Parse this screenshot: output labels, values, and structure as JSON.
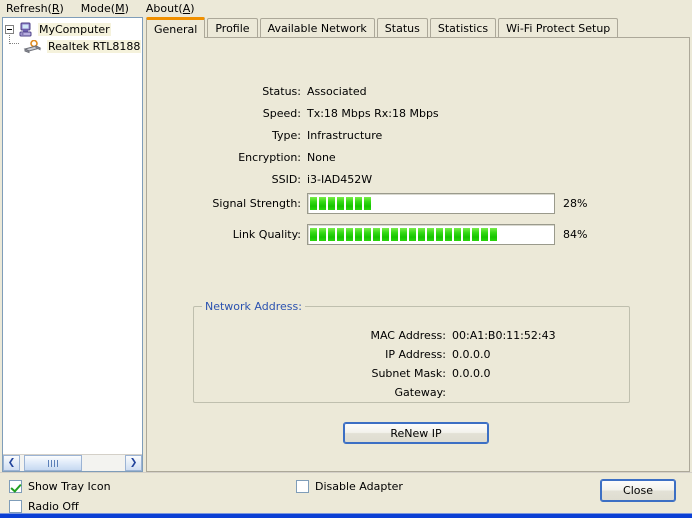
{
  "menu": {
    "items": [
      {
        "label": "Refresh(R)",
        "pre": "Refresh(",
        "key": "R",
        "post": ")"
      },
      {
        "label": "Mode(M)",
        "pre": "Mode(",
        "key": "M",
        "post": ")"
      },
      {
        "label": "About(A)",
        "pre": "About(",
        "key": "A",
        "post": ")"
      }
    ]
  },
  "tree": {
    "root_label": "MyComputer",
    "child_label": "Realtek RTL8188"
  },
  "scrollbar": {
    "left_arrow": "❮",
    "right_arrow": "❯"
  },
  "tabs": [
    {
      "label": "General",
      "active": true
    },
    {
      "label": "Profile",
      "active": false
    },
    {
      "label": "Available Network",
      "active": false
    },
    {
      "label": "Status",
      "active": false
    },
    {
      "label": "Statistics",
      "active": false
    },
    {
      "label": "Wi-Fi Protect Setup",
      "active": false
    }
  ],
  "general": {
    "fields": [
      {
        "label": "Status:",
        "value": "Associated"
      },
      {
        "label": "Speed:",
        "value": "Tx:18 Mbps Rx:18 Mbps"
      },
      {
        "label": "Type:",
        "value": "Infrastructure"
      },
      {
        "label": "Encryption:",
        "value": "None"
      },
      {
        "label": "SSID:",
        "value": "i3-IAD452W"
      }
    ],
    "meters": [
      {
        "label": "Signal Strength:",
        "percent_text": "28%",
        "percent": 28,
        "segments_total": 25,
        "segments_filled": 7
      },
      {
        "label": "Link Quality:",
        "percent_text": "84%",
        "percent": 84,
        "segments_total": 25,
        "segments_filled": 21
      }
    ],
    "network_address": {
      "legend": "Network Address:",
      "fields": [
        {
          "label": "MAC Address:",
          "value": "00:A1:B0:11:52:43"
        },
        {
          "label": "IP Address:",
          "value": "0.0.0.0"
        },
        {
          "label": "Subnet Mask:",
          "value": "0.0.0.0"
        },
        {
          "label": "Gateway:",
          "value": ""
        }
      ]
    },
    "renew_button": "ReNew IP"
  },
  "footer": {
    "show_tray_icon": {
      "label": "Show Tray Icon",
      "checked": true
    },
    "radio_off": {
      "label": "Radio Off",
      "checked": false
    },
    "disable_adapter": {
      "label": "Disable Adapter",
      "checked": false
    },
    "close_button": "Close"
  },
  "colors": {
    "accent_orange": "#F09000",
    "legend_blue": "#2B52B0",
    "meter_green": "#26D408",
    "window_bg": "#ECE9D8"
  }
}
